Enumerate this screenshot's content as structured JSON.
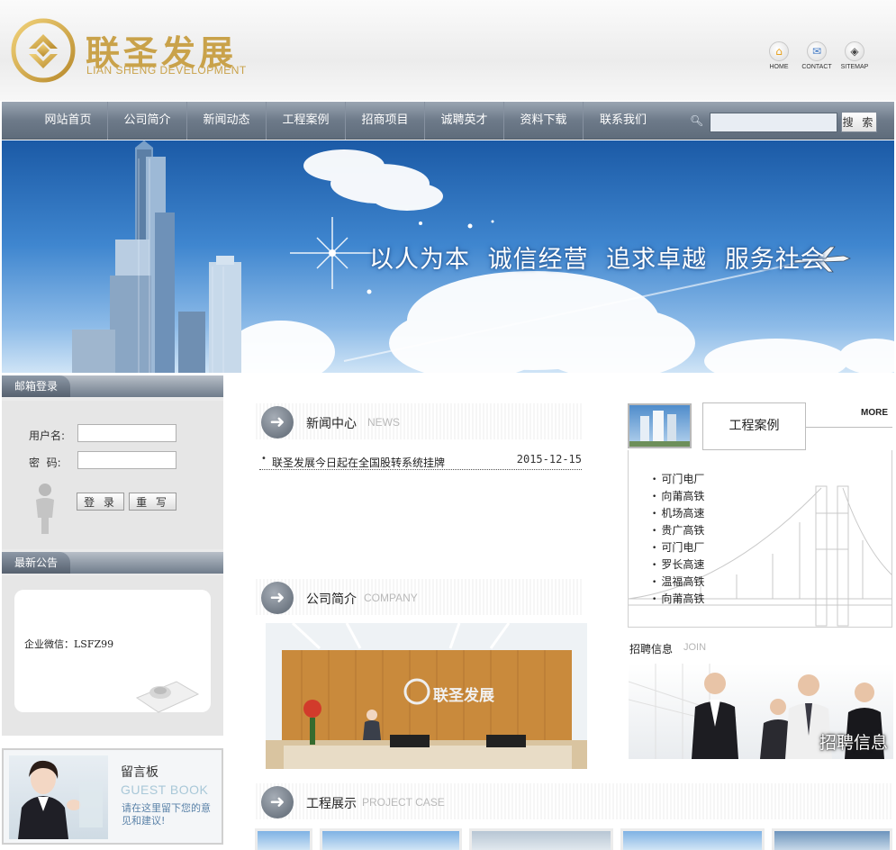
{
  "header": {
    "brand_cn": "联圣发展",
    "brand_en": "LIAN SHENG DEVELOPMENT",
    "brand_color": "#c9a24a",
    "top_links": [
      {
        "label": "HOME",
        "icon": "home-icon"
      },
      {
        "label": "CONTACT",
        "icon": "mail-icon"
      },
      {
        "label": "SITEMAP",
        "icon": "compass-icon"
      }
    ]
  },
  "nav": {
    "items": [
      "网站首页",
      "公司简介",
      "新闻动态",
      "工程案例",
      "招商项目",
      "诚聘英才",
      "资料下载",
      "联系我们"
    ],
    "search_button": "搜 索",
    "search_value": ""
  },
  "banner": {
    "slogan": "以人为本 诚信经营 追求卓越 服务社会"
  },
  "mail_login": {
    "title": "邮箱登录",
    "username_label": "用户名:",
    "password_label": "密  码:",
    "login_button": "登 录",
    "reset_button": "重 写"
  },
  "notice": {
    "title": "最新公告",
    "text": "企业微信：LSFZ99"
  },
  "guestbook": {
    "title": "留言板",
    "subtitle": "GUEST BOOK",
    "desc": "请在这里留下您的意见和建议!"
  },
  "news": {
    "title_cn": "新闻中心",
    "title_en": "NEWS",
    "items": [
      {
        "title": "联圣发展今日起在全国股转系统挂牌",
        "date": "2015-12-15"
      }
    ]
  },
  "company": {
    "title_cn": "公司简介",
    "title_en": "COMPANY",
    "sign": "联圣发展"
  },
  "cases": {
    "title": "工程案例",
    "more": "MORE",
    "items": [
      "可门电厂",
      "向莆高铁",
      "机场高速",
      "贵广高铁",
      "可门电厂",
      "罗长高速",
      "温福高铁",
      "向莆高铁"
    ]
  },
  "join": {
    "title_cn": "招聘信息",
    "title_en": "JOIN",
    "caption": "招聘信息"
  },
  "projects": {
    "title_cn": "工程展示",
    "title_en": "PROJECT CASE"
  }
}
